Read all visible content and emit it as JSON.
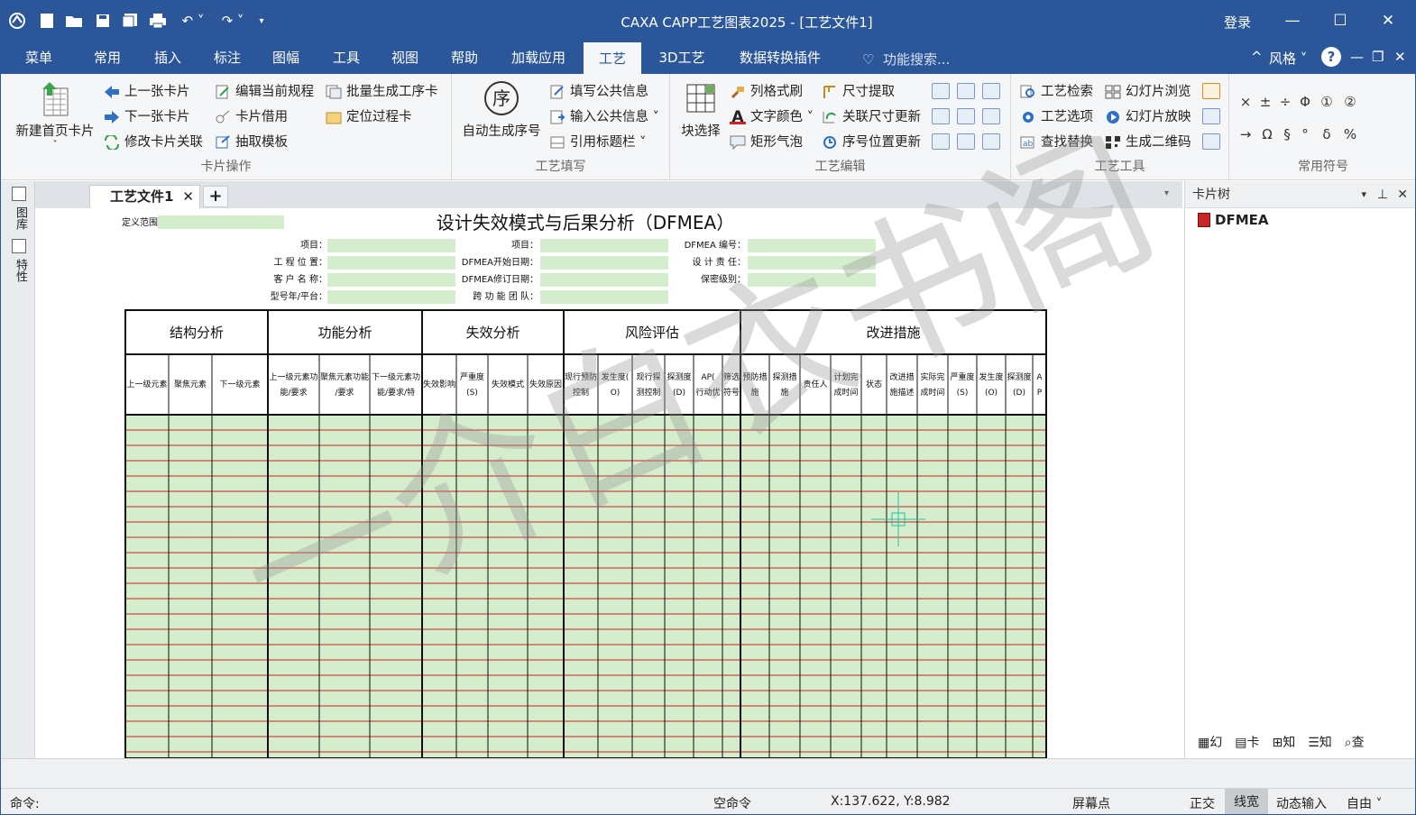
{
  "window": {
    "title": "CAXA CAPP工艺图表2025 - [工艺文件1]",
    "login": "登录"
  },
  "menu_tabs": [
    "菜单",
    "常用",
    "插入",
    "标注",
    "图幅",
    "工具",
    "视图",
    "帮助",
    "加载应用",
    "工艺",
    "3D工艺",
    "数据转换插件"
  ],
  "active_tab": "工艺",
  "search_placeholder": "功能搜索...",
  "style_label": "风格",
  "ribbon": {
    "card_ops": {
      "label": "卡片操作",
      "new_card": "新建首页卡片",
      "prev": "上一张卡片",
      "next": "下一张卡片",
      "modify_link": "修改卡片关联",
      "edit_rule": "编辑当前规程",
      "borrow": "卡片借用",
      "extract_tpl": "抽取模板",
      "batch_gen": "批量生成工序卡",
      "locate": "定位过程卡"
    },
    "fill": {
      "label": "工艺填写",
      "auto_seq": "自动生成序号",
      "seq_char": "序",
      "fill_public": "填写公共信息",
      "input_public": "输入公共信息",
      "ref_title": "引用标题栏"
    },
    "edit": {
      "label": "工艺编辑",
      "block_select": "块选择",
      "col_brush": "列格式刷",
      "text_color": "文字颜色",
      "rect_bubble": "矩形气泡",
      "dim_extract": "尺寸提取",
      "link_dim_update": "关联尺寸更新",
      "seq_pos_update": "序号位置更新"
    },
    "tools": {
      "label": "工艺工具",
      "check": "工艺检索",
      "options": "工艺选项",
      "find_replace": "查找替换",
      "slide_browse": "幻灯片浏览",
      "slide_play": "幻灯片放映",
      "qr": "生成二维码"
    },
    "symbols": {
      "label": "常用符号",
      "row1": [
        "×",
        "±",
        "÷",
        "Φ",
        "①",
        "②"
      ],
      "row2": [
        "→",
        "Ω",
        "§",
        "°",
        "δ",
        "%"
      ]
    }
  },
  "left_strip": [
    "图库",
    "特性"
  ],
  "doc_tab": "工艺文件1",
  "form": {
    "title": "设计失效模式与后果分析（DFMEA）",
    "scope_label": "定义范围",
    "header_col1": [
      "项目：",
      "工 程 位 置：",
      "客 户 名 称：",
      "型号年/平台："
    ],
    "header_col2": [
      "项目：",
      "DFMEA开始日期：",
      "DFMEA修订日期：",
      "跨 功 能 团 队："
    ],
    "header_col3": [
      "DFMEA 编号：",
      "设 计 责 任：",
      "保密级别："
    ],
    "groups": [
      "结构分析",
      "功能分析",
      "失效分析",
      "风险评估",
      "改进措施"
    ],
    "columns": [
      "上一级元素",
      "聚焦元素",
      "下一级元素",
      "上一级元素功能/要求",
      "聚焦元素功能/要求",
      "下一级元素功能/要求/特性",
      "失效影响",
      "严重度(S)",
      "失效模式",
      "失效原因",
      "现行预防控制",
      "发生度(O)",
      "现行探测控制",
      "探测度(D)",
      "AP(行动优先级)",
      "筛选符号",
      "预防措施",
      "探测措施",
      "责任人",
      "计划完成时间",
      "状态",
      "改进措施描述",
      "实际完成时间",
      "严重度(S)",
      "发生度(O)",
      "探测度(D)",
      "AP"
    ]
  },
  "card_tree": {
    "header": "卡片树",
    "root": "DFMEA",
    "bottom_tabs": [
      "幻",
      "卡",
      "知",
      "知",
      "查"
    ]
  },
  "status": {
    "cmd": "命令:",
    "empty_cmd": "空命令",
    "coords": "X:137.622, Y:8.982",
    "screen_pt": "屏幕点",
    "ortho": "正交",
    "line_width": "线宽",
    "dyn_input": "动态输入",
    "free": "自由"
  },
  "watermark": "一介白衣书阁",
  "colors": {
    "accent": "#2b579a",
    "cell_green": "#d4edcc",
    "row_line": "#d02020"
  }
}
